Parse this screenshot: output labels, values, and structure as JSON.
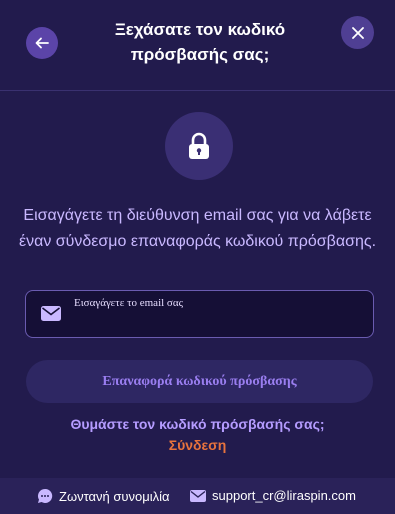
{
  "header": {
    "title_line1": "Ξεχάσατε τον κωδικό",
    "title_line2": "πρόσβασής σας;",
    "back_icon": "arrow-left-icon",
    "close_icon": "close-icon"
  },
  "main": {
    "lock_icon": "lock-icon",
    "description": "Εισαγάγετε τη διεύθυνση email σας για να λάβετε έναν σύνδεσμο επαναφοράς κωδικού πρόσβασης.",
    "email_field": {
      "placeholder": "Εισαγάγετε το email σας",
      "value": ""
    },
    "reset_button_label": "Επαναφορά κωδικού πρόσβασης",
    "remember_text": "Θυμάστε τον κωδικό πρόσβασής σας;",
    "login_link_label": "Σύνδεση"
  },
  "footer": {
    "chat_label": "Ζωντανή συνομιλία",
    "email_label": "support_cr@liraspin.com"
  },
  "colors": {
    "background": "#221b4d",
    "accent_purple": "#5b44a8",
    "link_orange": "#e8733d",
    "text_lavender": "#c9b8ff"
  }
}
